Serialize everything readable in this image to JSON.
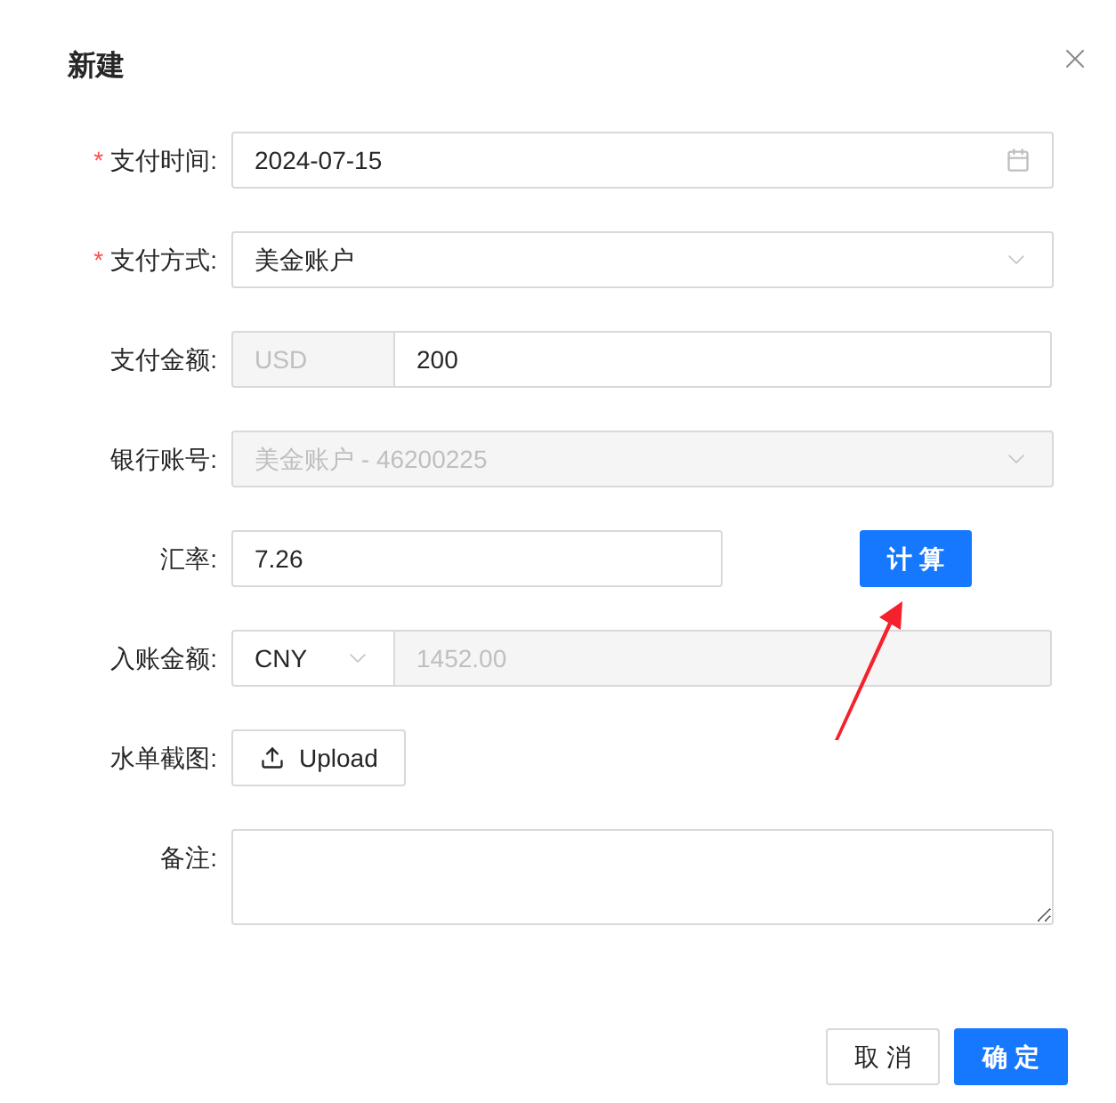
{
  "dialog": {
    "title": "新建"
  },
  "fields": [
    {
      "kind": "date",
      "label": "支付时间:",
      "required_mark": "*",
      "disabled": false,
      "value": "2024-07-15"
    },
    {
      "kind": "select",
      "label": "支付方式:",
      "required_mark": "*",
      "disabled": false,
      "value": "美金账户"
    },
    {
      "kind": "addon-input",
      "label": "支付金额:",
      "disabled": false,
      "addon": "USD",
      "value": "200"
    },
    {
      "kind": "select",
      "label": "银行账号:",
      "disabled": true,
      "value": "美金账户 - 46200225"
    },
    {
      "kind": "input-button",
      "label": "汇率:",
      "disabled": false,
      "value": "7.26",
      "button": "计 算"
    },
    {
      "kind": "select-addon",
      "label": "入账金额:",
      "disabled": true,
      "addon": "CNY",
      "value": "1452.00"
    },
    {
      "kind": "upload",
      "label": "水单截图:",
      "disabled": false,
      "button": "Upload"
    },
    {
      "kind": "textarea",
      "label": "备注:"
    }
  ],
  "footer": {
    "buttons": [
      {
        "label": "取 消",
        "kind": "default"
      },
      {
        "label": "确 定",
        "kind": "primary"
      }
    ]
  }
}
